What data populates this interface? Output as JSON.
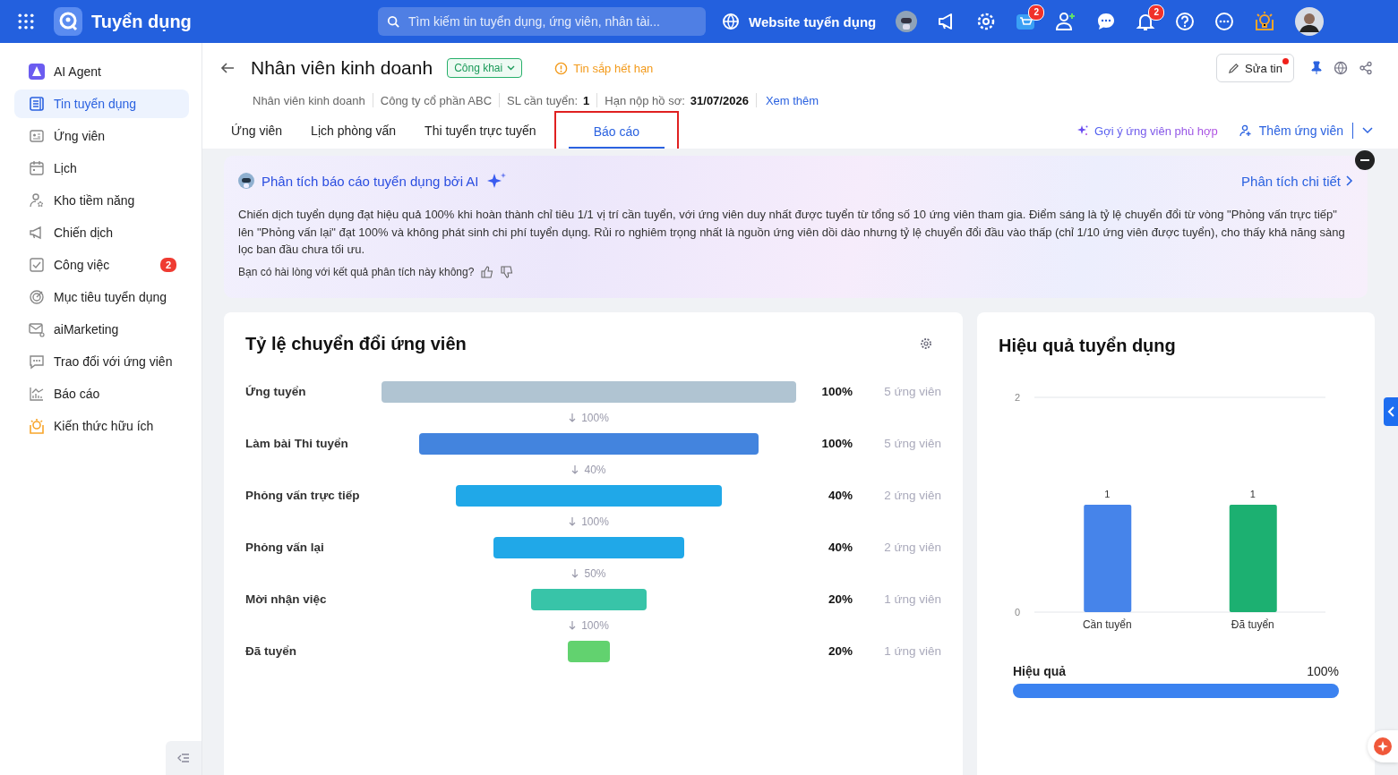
{
  "topbar": {
    "app_title": "Tuyển dụng",
    "search": {
      "placeholder": "Tìm kiếm tin tuyển dụng, ứng viên, nhân tài..."
    },
    "website_link": "Website tuyển dụng",
    "cart_badge": "2",
    "bell_badge": "2"
  },
  "sidebar": {
    "items": [
      {
        "label": "AI Agent",
        "selected": false
      },
      {
        "label": "Tin tuyển dụng",
        "selected": true
      },
      {
        "label": "Ứng viên",
        "selected": false
      },
      {
        "label": "Lịch",
        "selected": false
      },
      {
        "label": "Kho tiềm năng",
        "selected": false
      },
      {
        "label": "Chiến dịch",
        "selected": false
      },
      {
        "label": "Công việc",
        "selected": false,
        "badge": "2"
      },
      {
        "label": "Mục tiêu tuyển dụng",
        "selected": false
      },
      {
        "label": "aiMarketing",
        "selected": false
      },
      {
        "label": "Trao đổi với ứng viên",
        "selected": false
      },
      {
        "label": "Báo cáo",
        "selected": false
      },
      {
        "label": "Kiến thức hữu ích",
        "selected": false
      }
    ]
  },
  "header": {
    "title": "Nhân viên kinh doanh",
    "visibility": "Công khai",
    "warning": "Tin sắp hết hạn",
    "edit_button": "Sửa tin",
    "meta": [
      {
        "label": "Nhân viên kinh doanh"
      },
      {
        "label": "Công ty cổ phần ABC"
      },
      {
        "label": "SL cần tuyển:",
        "value": "1"
      },
      {
        "label": "Hạn nộp hồ sơ:",
        "value": "31/07/2026"
      }
    ],
    "more_link": "Xem thêm"
  },
  "tabs": [
    {
      "label": "Ứng viên",
      "selected": false
    },
    {
      "label": "Lịch phòng vấn",
      "selected": false
    },
    {
      "label": "Thi tuyển trực tuyến",
      "selected": false
    },
    {
      "label": "Báo cáo",
      "selected": true
    }
  ],
  "actions": {
    "suggest": "Gợi ý ứng viên phù hợp",
    "add": "Thêm ứng viên"
  },
  "ai_panel": {
    "title": "Phân tích báo cáo tuyển dụng bởi AI",
    "detail_link": "Phân tích chi tiết",
    "text": "Chiến dịch tuyển dụng đạt hiệu quả 100% khi hoàn thành chỉ tiêu 1/1 vị trí cần tuyển, với ứng viên duy nhất được tuyển từ tổng số 10 ứng viên tham gia. Điểm sáng là tỷ lệ chuyển đổi từ vòng \"Phỏng vấn trực tiếp\" lên \"Phỏng vấn lại\" đạt 100% và không phát sinh chi phí tuyển dụng. Rủi ro nghiêm trọng nhất là nguồn ứng viên dồi dào nhưng tỷ lệ chuyển đổi đầu vào thấp (chỉ 1/10 ứng viên được tuyển), cho thấy khả năng sàng lọc ban đầu chưa tối ưu.",
    "feedback": "Bạn có hài lòng với kết quả phân tích này không?"
  },
  "funnel": {
    "title": "Tỷ lệ chuyển đổi ứng viên",
    "stages": [
      {
        "name": "Ứng tuyển",
        "color": "#b0c4d2",
        "percent": "100%",
        "count": "5 ứng viên",
        "next": "100%"
      },
      {
        "name": "Làm bài Thi tuyển",
        "color": "#4384de",
        "percent": "100%",
        "count": "5 ứng viên",
        "next": "40%"
      },
      {
        "name": "Phỏng vấn trực tiếp",
        "color": "#20a8e8",
        "percent": "40%",
        "count": "2 ứng viên",
        "next": "100%"
      },
      {
        "name": "Phỏng vấn lại",
        "color": "#20a8e8",
        "percent": "40%",
        "count": "2 ứng viên",
        "next": "50%"
      },
      {
        "name": "Mời nhận việc",
        "color": "#38c4a8",
        "percent": "20%",
        "count": "1 ứng viên",
        "next": "100%"
      },
      {
        "name": "Đã tuyển",
        "color": "#62d26f",
        "percent": "20%",
        "count": "1 ứng viên"
      }
    ]
  },
  "efficiency": {
    "title": "Hiệu quả tuyển dụng",
    "chart_data": {
      "type": "bar",
      "categories": [
        "Cần tuyển",
        "Đã tuyển"
      ],
      "values": [
        1,
        1
      ],
      "ylim": [
        0,
        2
      ],
      "yticks": [
        0,
        2
      ],
      "data_labels": true
    },
    "progress": {
      "label": "Hiệu quả",
      "reading": "100%",
      "level": 1
    }
  }
}
